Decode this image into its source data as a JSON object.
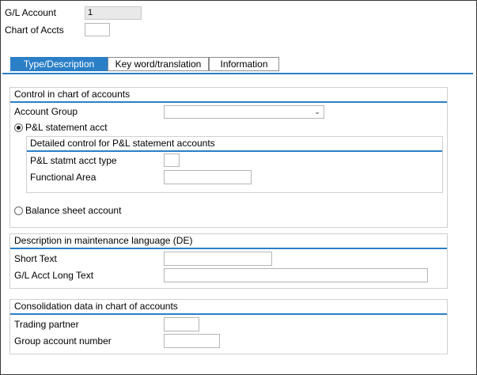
{
  "header": {
    "gl_account_label": "G/L Account",
    "gl_account_value": "1",
    "chart_of_accts_label": "Chart of Accts",
    "chart_of_accts_value": ""
  },
  "tabs": [
    {
      "label": "Type/Description",
      "active": true
    },
    {
      "label": "Key word/translation",
      "active": false
    },
    {
      "label": "Information",
      "active": false
    }
  ],
  "control_group": {
    "title": "Control in chart of accounts",
    "account_group_label": "Account Group",
    "account_group_value": "",
    "pl_radio_label": "P&L statement acct",
    "pl_selected": true,
    "pl_subgroup": {
      "title": "Detailed control for P&L statement accounts",
      "pl_type_label": "P&L statmt acct type",
      "pl_type_value": "",
      "functional_area_label": "Functional Area",
      "functional_area_value": ""
    },
    "balance_radio_label": "Balance sheet account",
    "balance_selected": false
  },
  "description_group": {
    "title": "Description in maintenance language (DE)",
    "short_text_label": "Short Text",
    "short_text_value": "",
    "long_text_label": "G/L Acct Long Text",
    "long_text_value": ""
  },
  "consolidation_group": {
    "title": "Consolidation data in chart of accounts",
    "trading_partner_label": "Trading partner",
    "trading_partner_value": "",
    "group_account_label": "Group account number",
    "group_account_value": ""
  },
  "colors": {
    "accent": "#2a7fc7",
    "readonly_field": "#e9e9e9"
  },
  "icons": {
    "dropdown": "chevron-down-icon"
  }
}
